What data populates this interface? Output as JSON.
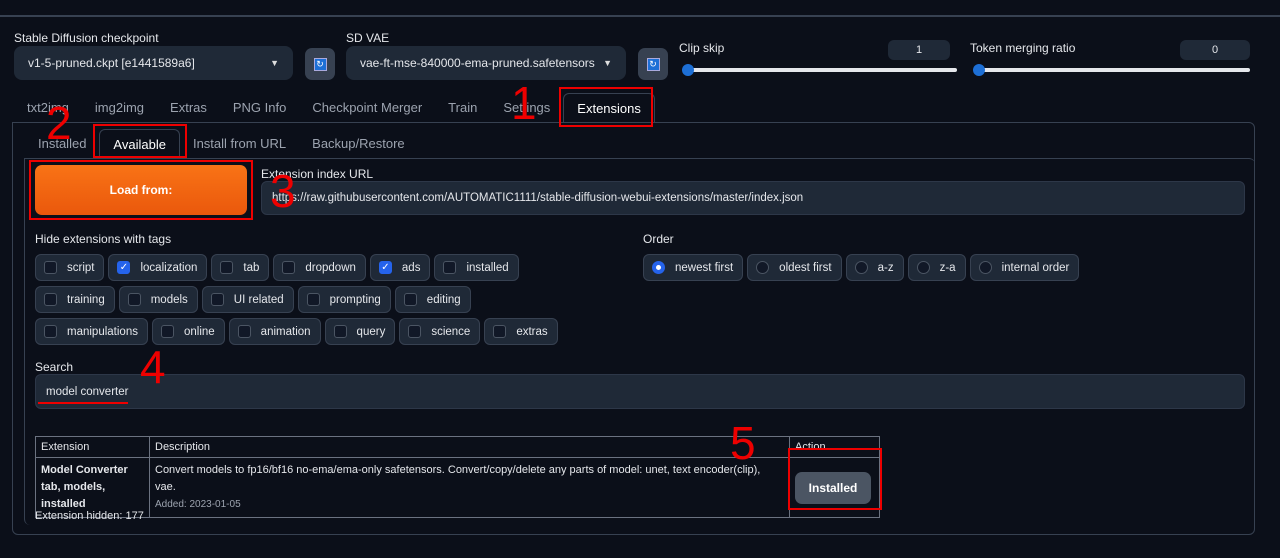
{
  "settings": {
    "checkpoint_label": "Stable Diffusion checkpoint",
    "checkpoint_value": "v1-5-pruned.ckpt [e1441589a6]",
    "vae_label": "SD VAE",
    "vae_value": "vae-ft-mse-840000-ema-pruned.safetensors",
    "clip_skip_label": "Clip skip",
    "clip_skip_value": "1",
    "token_merging_label": "Token merging ratio",
    "token_merging_value": "0"
  },
  "tabs": [
    "txt2img",
    "img2img",
    "Extras",
    "PNG Info",
    "Checkpoint Merger",
    "Train",
    "Settings",
    "Extensions"
  ],
  "subtabs": [
    "Installed",
    "Available",
    "Install from URL",
    "Backup/Restore"
  ],
  "load_button": "Load from:",
  "index_url_label": "Extension index URL",
  "index_url_value": "https://raw.githubusercontent.com/AUTOMATIC1111/stable-diffusion-webui-extensions/master/index.json",
  "hide_tags_label": "Hide extensions with tags",
  "tags": [
    {
      "l": "script",
      "c": false
    },
    {
      "l": "localization",
      "c": true
    },
    {
      "l": "tab",
      "c": false
    },
    {
      "l": "dropdown",
      "c": false
    },
    {
      "l": "ads",
      "c": true
    },
    {
      "l": "installed",
      "c": false
    },
    {
      "l": "training",
      "c": false
    },
    {
      "l": "models",
      "c": false
    },
    {
      "l": "UI related",
      "c": false
    },
    {
      "l": "prompting",
      "c": false
    },
    {
      "l": "editing",
      "c": false
    },
    {
      "l": "manipulations",
      "c": false
    },
    {
      "l": "online",
      "c": false
    },
    {
      "l": "animation",
      "c": false
    },
    {
      "l": "query",
      "c": false
    },
    {
      "l": "science",
      "c": false
    },
    {
      "l": "extras",
      "c": false
    }
  ],
  "order_label": "Order",
  "order": [
    {
      "l": "newest first",
      "c": true
    },
    {
      "l": "oldest first",
      "c": false
    },
    {
      "l": "a-z",
      "c": false
    },
    {
      "l": "z-a",
      "c": false
    },
    {
      "l": "internal order",
      "c": false
    }
  ],
  "search_label": "Search",
  "search_value": "model converter",
  "table": {
    "headers": [
      "Extension",
      "Description",
      "Action"
    ],
    "rows": [
      {
        "name": "Model Converter",
        "tags": "tab, models, installed",
        "desc": "Convert models to fp16/bf16 no-ema/ema-only safetensors. Convert/copy/delete any parts of model: unet, text encoder(clip), vae.",
        "added": "Added: 2023-01-05",
        "action": "Installed"
      }
    ]
  },
  "hidden_count": "Extension hidden: 177",
  "annotations": [
    "1",
    "2",
    "3",
    "4",
    "5"
  ]
}
